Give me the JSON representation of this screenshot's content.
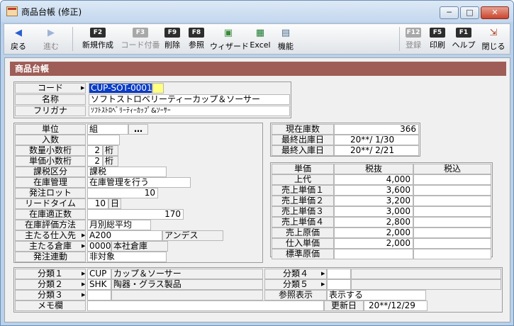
{
  "window": {
    "title": "商品台帳 (修正)",
    "controls": [
      "─",
      "□",
      "✕"
    ]
  },
  "toolbar": [
    {
      "key": "",
      "label": "戻る",
      "icon": "◀",
      "disabled": false
    },
    {
      "key": "",
      "label": "進む",
      "icon": "▶",
      "disabled": true
    },
    {
      "key": "F2",
      "label": "新規作成",
      "disabled": false
    },
    {
      "key": "F3",
      "label": "コード付番",
      "disabled": true
    },
    {
      "key": "F9",
      "label": "削除",
      "disabled": false
    },
    {
      "key": "F8",
      "label": "参照",
      "disabled": false
    },
    {
      "key": "",
      "label": "ウィザード",
      "icon": "▣",
      "disabled": false
    },
    {
      "key": "",
      "label": "Excel",
      "icon": "▦",
      "disabled": false
    },
    {
      "key": "",
      "label": "機能",
      "icon": "▤",
      "disabled": false
    },
    {
      "key": "F12",
      "label": "登録",
      "disabled": true
    },
    {
      "key": "F5",
      "label": "印刷",
      "disabled": false
    },
    {
      "key": "F1",
      "label": "ヘルプ",
      "disabled": false
    },
    {
      "key": "",
      "label": "閉じる",
      "icon": "⇲",
      "disabled": false
    }
  ],
  "section_title": "商品台帳",
  "head": {
    "code_label": "コード",
    "code_value": "CUP-SOT-0001",
    "name_label": "名称",
    "name_value": "ソフトストロベリーティーカップ＆ソーサー",
    "kana_label": "フリガナ",
    "kana_value": "ｿﾌﾄｽﾄﾛﾍﾞﾘｰﾃｨｰｶｯﾌﾟ&ｿｰｻｰ"
  },
  "left": {
    "unit": {
      "label": "単位",
      "value": "組",
      "button": "…"
    },
    "irisu": {
      "label": "入数",
      "value": ""
    },
    "qty_digits": {
      "label": "数量小数桁",
      "value": "2",
      "unit": "桁"
    },
    "price_digits": {
      "label": "単価小数桁",
      "value": "2",
      "unit": "桁"
    },
    "tax": {
      "label": "課税区分",
      "value": "課税"
    },
    "stock_mgmt": {
      "label": "在庫管理",
      "value": "在庫管理を行う"
    },
    "lot": {
      "label": "発注ロット",
      "value": "10"
    },
    "lead": {
      "label": "リードタイム",
      "value": "10",
      "unit": "日"
    },
    "proper": {
      "label": "在庫適正数",
      "value": "170"
    },
    "eval": {
      "label": "在庫評価方法",
      "value": "月別総平均"
    },
    "supplier": {
      "label": "主たる仕入先",
      "code": "A200",
      "name": "アンデス"
    },
    "warehouse": {
      "label": "主たる倉庫",
      "code": "0000",
      "name": "本社倉庫"
    },
    "order_link": {
      "label": "発注連動",
      "value": "非対象"
    }
  },
  "stock": [
    {
      "label": "現在庫数",
      "value": "366"
    },
    {
      "label": "最終出庫日",
      "value": "20**/ 1/30"
    },
    {
      "label": "最終入庫日",
      "value": "20**/ 2/21"
    }
  ],
  "price": {
    "headers": [
      "単価",
      "税抜",
      "税込"
    ],
    "rows": [
      {
        "label": "上代",
        "ex": "4,000",
        "in": ""
      },
      {
        "label": "売上単価１",
        "ex": "3,600",
        "in": ""
      },
      {
        "label": "売上単価２",
        "ex": "3,200",
        "in": ""
      },
      {
        "label": "売上単価３",
        "ex": "3,000",
        "in": ""
      },
      {
        "label": "売上単価４",
        "ex": "2,800",
        "in": ""
      },
      {
        "label": "売上原価",
        "ex": "2,000",
        "in": ""
      },
      {
        "label": "仕入単価",
        "ex": "2,000",
        "in": ""
      },
      {
        "label": "標準原価",
        "ex": "",
        "in": ""
      }
    ]
  },
  "bottom": {
    "c1": {
      "label": "分類１",
      "code": "CUP",
      "name": "カップ＆ソーサー"
    },
    "c2": {
      "label": "分類２",
      "code": "SHK",
      "name": "陶器・グラス製品"
    },
    "c3": {
      "label": "分類３",
      "code": "",
      "name": ""
    },
    "c4": {
      "label": "分類４",
      "code": "",
      "name": ""
    },
    "c5": {
      "label": "分類５",
      "code": "",
      "name": ""
    },
    "ref": {
      "label": "参照表示",
      "value": "表示する"
    },
    "memo": {
      "label": "メモ欄",
      "value": ""
    },
    "updated": {
      "label": "更新日",
      "value": "20**/12/29"
    }
  }
}
